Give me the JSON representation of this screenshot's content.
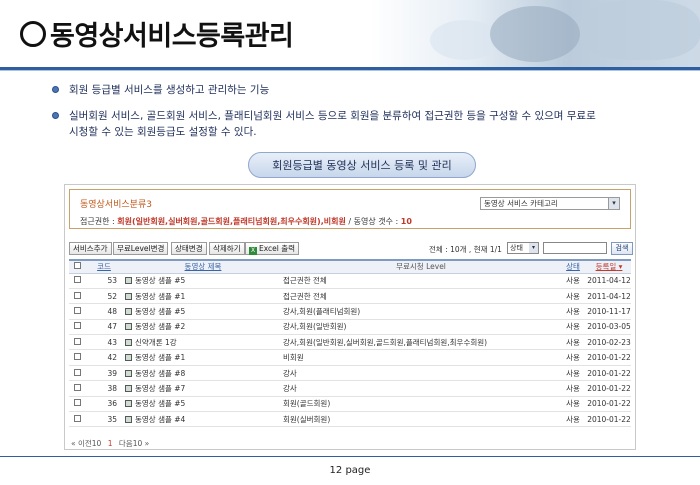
{
  "header": {
    "title": "동영상서비스등록관리"
  },
  "bullets": [
    "회원 등급별 서비스를 생성하고 관리하는 기능",
    "실버회원 서비스, 골드회원 서비스, 플래티넘회원 서비스 등으로 회원을 분류하여 접근권한 등을 구성할 수 있으며 무료로",
    "시청할 수 있는 회원등급도 설정할 수 있다."
  ],
  "section_pill": "회원등급별 동영상 서비스 등록 및 관리",
  "category": {
    "title": "동영상서비스분류3",
    "select_value": "동영상 서비스 카테고리",
    "access_label": "접근권한 :",
    "access_value": "회원(일반회원,실버회원,골드회원,플래티넘회원,최우수회원),비회원",
    "video_count_label": "/ 동영상 갯수 :",
    "video_count": "10"
  },
  "toolbar": {
    "add": "서비스추가",
    "free_level": "무료Level변경",
    "status_change": "상태변경",
    "delete": "삭제하기",
    "excel": "Excel 출력",
    "count": "전체 : 10개 , 현재 1/1",
    "status_select": "상태",
    "search": "검색"
  },
  "table": {
    "headers": {
      "code": "코드",
      "title": "동영상 제목",
      "free_level": "무료시청 Level",
      "status": "상태",
      "date": "등록일"
    },
    "rows": [
      {
        "code": "53",
        "title": "동영상 샘플 #5",
        "level": "접근권한 전체",
        "status": "사용",
        "date": "2011-04-12"
      },
      {
        "code": "52",
        "title": "동영상 샘플 #1",
        "level": "접근권한 전체",
        "status": "사용",
        "date": "2011-04-12"
      },
      {
        "code": "48",
        "title": "동영상 샘플 #5",
        "level": "강사,회원(플래티넘회원)",
        "status": "사용",
        "date": "2010-11-17"
      },
      {
        "code": "47",
        "title": "동영상 샘플 #2",
        "level": "강사,회원(일반회원)",
        "status": "사용",
        "date": "2010-03-05"
      },
      {
        "code": "43",
        "title": "신약개론 1강",
        "level": "강사,회원(일반회원,실버회원,골드회원,플래티넘회원,최우수회원)",
        "status": "사용",
        "date": "2010-02-23"
      },
      {
        "code": "42",
        "title": "동영상 샘플 #1",
        "level": "비회원",
        "status": "사용",
        "date": "2010-01-22"
      },
      {
        "code": "39",
        "title": "동영상 샘플 #8",
        "level": "강사",
        "status": "사용",
        "date": "2010-01-22"
      },
      {
        "code": "38",
        "title": "동영상 샘플 #7",
        "level": "강사",
        "status": "사용",
        "date": "2010-01-22"
      },
      {
        "code": "36",
        "title": "동영상 샘플 #5",
        "level": "회원(골드회원)",
        "status": "사용",
        "date": "2010-01-22"
      },
      {
        "code": "35",
        "title": "동영상 샘플 #4",
        "level": "회원(실버회원)",
        "status": "사용",
        "date": "2010-01-22"
      }
    ]
  },
  "pager": {
    "prev": "« 이전10",
    "current": "1",
    "next": "다음10 »"
  },
  "footer": {
    "page": "12 page"
  }
}
